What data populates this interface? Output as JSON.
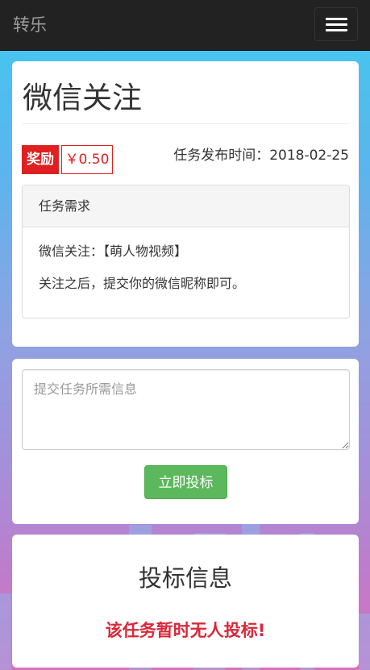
{
  "navbar": {
    "brand": "转乐",
    "menu_icon": "hamburger-menu-icon"
  },
  "task": {
    "title": "微信关注",
    "reward_label": "奖励",
    "reward_amount": "￥0.50",
    "publish_time_label": "任务发布时间：2018-02-25",
    "requirements": {
      "heading": "任务需求",
      "lines": [
        "微信关注：【萌人物视频】",
        "关注之后，提交你的微信昵称即可。"
      ]
    }
  },
  "submission": {
    "placeholder": "提交任务所需信息",
    "value": "",
    "button_label": "立即投标"
  },
  "bids": {
    "title": "投标信息",
    "empty_message": "该任务暂时无人投标!"
  },
  "colors": {
    "navbar_bg": "#222222",
    "reward_red": "#e02020",
    "button_green": "#5cb85c",
    "empty_message_red": "#d9283a"
  }
}
